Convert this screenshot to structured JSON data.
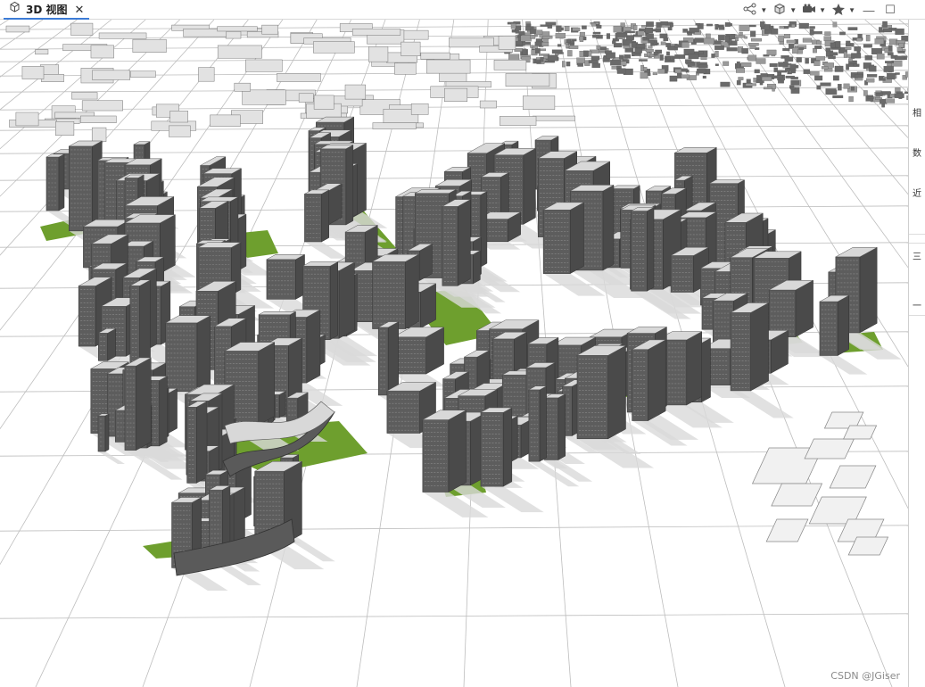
{
  "tab": {
    "icon": "cube-icon",
    "title": "3D 视图",
    "close_icon": "close-icon"
  },
  "toolbar": [
    {
      "name": "share-button",
      "icon": "share-nodes-icon",
      "has_dropdown": true
    },
    {
      "name": "layers-button",
      "icon": "cubes-icon",
      "has_dropdown": true
    },
    {
      "name": "camera-button",
      "icon": "video-camera-icon",
      "has_dropdown": true
    },
    {
      "name": "favorites-button",
      "icon": "star-icon",
      "has_dropdown": true
    },
    {
      "name": "minimize-button",
      "icon": "minimize-icon",
      "has_dropdown": false
    },
    {
      "name": "maximize-button",
      "icon": "maximize-icon",
      "has_dropdown": false
    }
  ],
  "side_panel": {
    "group1": [
      "相",
      "数",
      "近"
    ],
    "group2": [
      "三",
      "一"
    ]
  },
  "scene": {
    "description_colors": {
      "building": "#5d5d5d",
      "building_roof": "#d8d8d8",
      "green_space": "#6e9f2e",
      "grid_line": "#bdbdbd",
      "shadow": "#d9d9d9"
    }
  },
  "watermark": "CSDN @JGiser"
}
